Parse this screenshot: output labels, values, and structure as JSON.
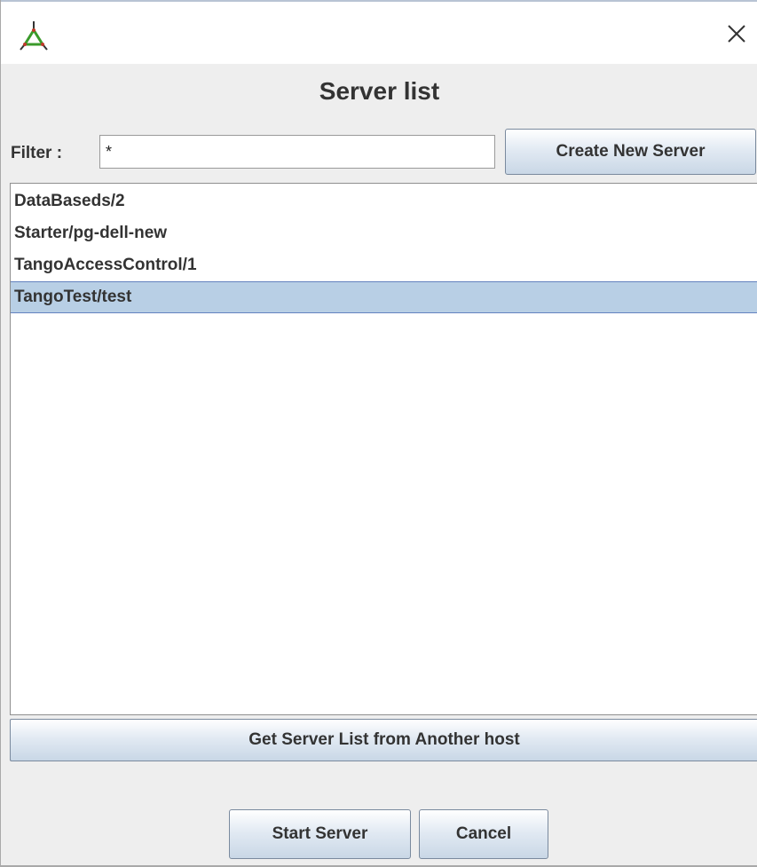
{
  "window": {
    "close_symbol": "✕"
  },
  "header": {
    "title": "Server list"
  },
  "filter": {
    "label": "Filter :",
    "value": "*"
  },
  "buttons": {
    "create_label": "Create New Server",
    "another_host_label": "Get Server List from Another host",
    "start_label": "Start Server",
    "cancel_label": "Cancel"
  },
  "servers": {
    "items": [
      {
        "label": "DataBaseds/2",
        "selected": false
      },
      {
        "label": "Starter/pg-dell-new",
        "selected": false
      },
      {
        "label": "TangoAccessControl/1",
        "selected": false
      },
      {
        "label": "TangoTest/test",
        "selected": true
      }
    ]
  },
  "icons": {
    "app": "tango-logo-icon",
    "close": "close-icon"
  },
  "colors": {
    "selection_bg": "#b8cfe5",
    "selection_border": "#6382bf",
    "button_gradient_bottom": "#c9d7e6"
  }
}
